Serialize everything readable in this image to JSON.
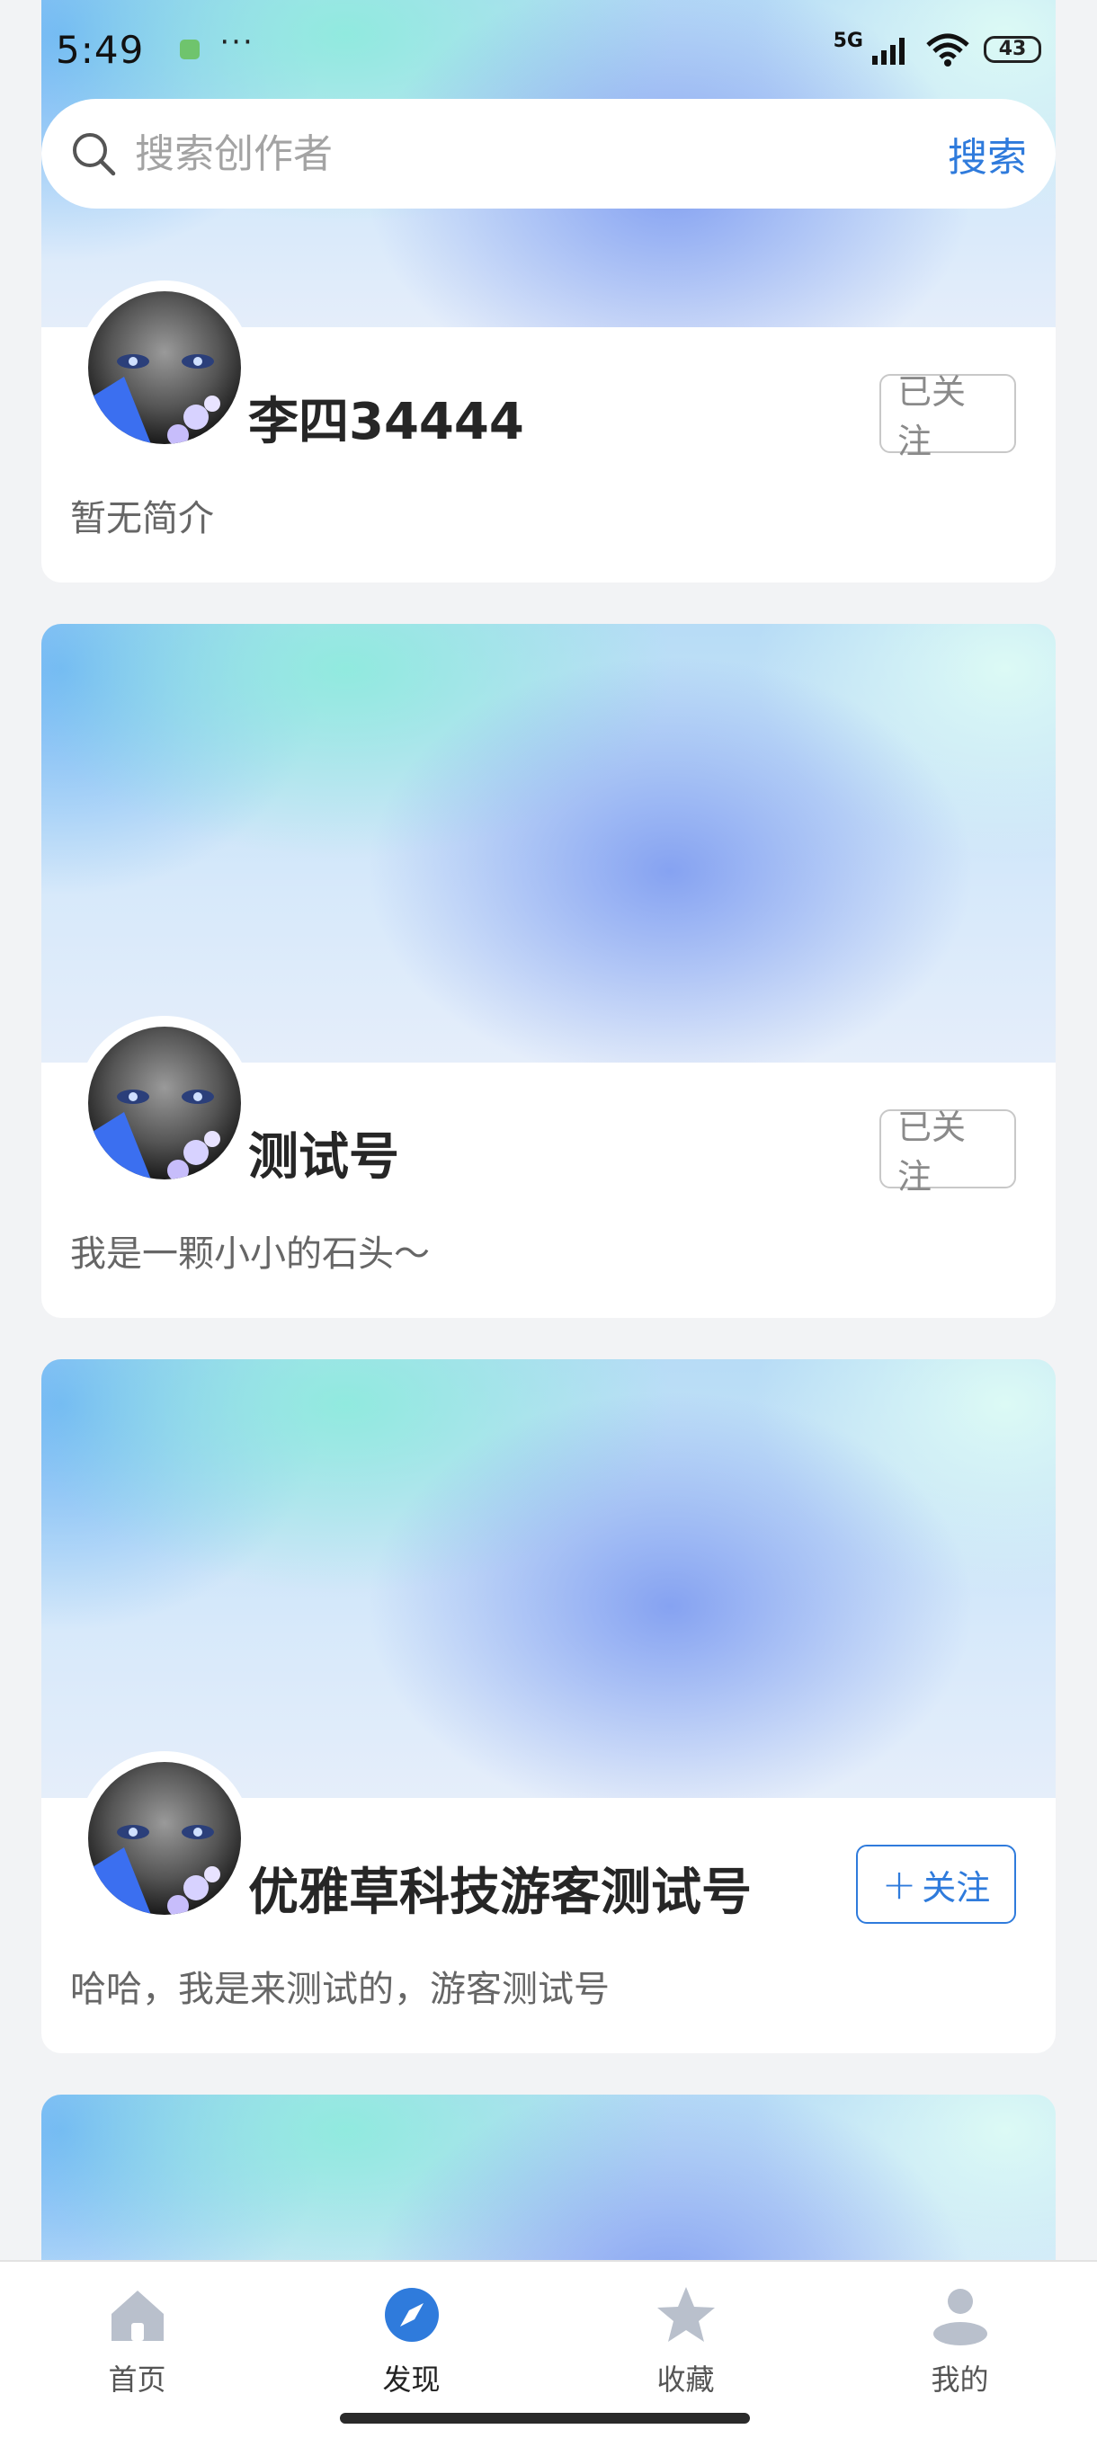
{
  "status_bar": {
    "time": "5:49",
    "network": "5G",
    "battery": "43"
  },
  "search": {
    "placeholder": "搜索创作者",
    "button_label": "搜索"
  },
  "creators": [
    {
      "name": "李四34444",
      "bio": "暂无简介",
      "follow_label": "已关注",
      "followed": true
    },
    {
      "name": "测试号",
      "bio": "我是一颗小小的石头～",
      "follow_label": "已关注",
      "followed": true
    },
    {
      "name": "优雅草科技游客测试号",
      "bio": "哈哈，我是来测试的，游客测试号",
      "follow_label": "关注",
      "followed": false
    }
  ],
  "tabs": [
    {
      "label": "首页",
      "icon": "home-icon",
      "active": false
    },
    {
      "label": "发现",
      "icon": "compass-icon",
      "active": true
    },
    {
      "label": "收藏",
      "icon": "star-icon",
      "active": false
    },
    {
      "label": "我的",
      "icon": "user-icon",
      "active": false
    }
  ],
  "colors": {
    "accent": "#2f7bdc",
    "inactive_tab": "#b9c0cc",
    "background": "#f2f3f5"
  }
}
